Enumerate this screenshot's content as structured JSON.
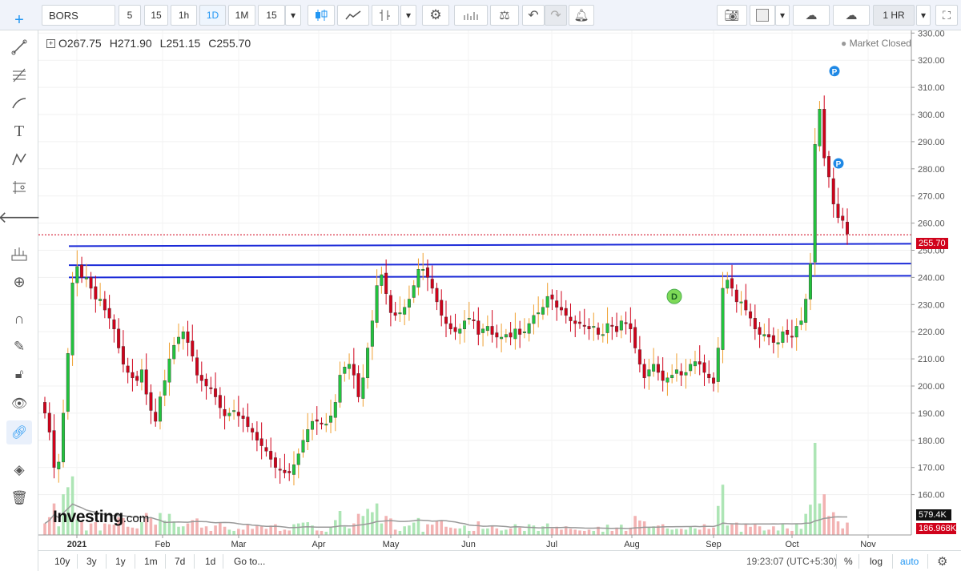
{
  "toolbar": {
    "symbol": "BORS",
    "intervals": [
      "5",
      "15",
      "1h",
      "1D",
      "1M",
      "15"
    ],
    "active_interval": "1D",
    "timezone_button": "1 HR"
  },
  "ohlc": {
    "open": "O267.75",
    "high": "H271.90",
    "low": "L251.15",
    "close": "C255.70"
  },
  "market_status": "Market Closed",
  "logo": {
    "main": "Investing",
    "suffix": ".com"
  },
  "bottom": {
    "ranges": [
      "10y",
      "3y",
      "1y",
      "1m",
      "7d",
      "1d"
    ],
    "goto": "Go to...",
    "clock": "19:23:07 (UTC+5:30)",
    "percent": "%",
    "log": "log",
    "auto": "auto"
  },
  "colors": {
    "up": "#22c33d",
    "down": "#d0021b",
    "line": "#1c2bd8",
    "accent": "#2196f3"
  },
  "chart_data": {
    "type": "candlestick",
    "price_axis": {
      "ticks": [
        160,
        170,
        180,
        190,
        200,
        210,
        220,
        230,
        240,
        250,
        260,
        270,
        280,
        290,
        300,
        310,
        320,
        330
      ]
    },
    "time_axis": {
      "labels": [
        "2021",
        "Feb",
        "Mar",
        "Apr",
        "May",
        "Jun",
        "Jul",
        "Aug",
        "Sep",
        "Oct",
        "Nov"
      ]
    },
    "last_price": "255.70",
    "volume_labels": [
      "579.4K",
      "186.968K"
    ],
    "horizontal_lines": [
      251.5,
      244.5,
      240.0
    ],
    "markers": [
      {
        "label": "P",
        "price": 316
      },
      {
        "label": "P",
        "price": 282
      },
      {
        "label": "D",
        "price": 233
      }
    ],
    "closes": [
      190,
      183,
      170,
      172,
      190,
      212,
      238,
      244,
      240,
      240,
      236,
      232,
      232,
      228,
      225,
      221,
      214,
      208,
      205,
      203,
      202,
      206,
      197,
      191,
      187,
      196,
      202,
      210,
      215,
      218,
      220,
      216,
      211,
      204,
      202,
      200,
      199,
      196,
      192,
      189,
      190,
      191,
      189,
      188,
      185,
      183,
      180,
      178,
      176,
      173,
      170,
      169,
      168,
      168,
      171,
      175,
      180,
      184,
      187,
      187,
      186,
      186,
      189,
      194,
      204,
      207,
      208,
      204,
      196,
      203,
      214,
      224,
      237,
      241,
      234,
      227,
      226,
      227,
      229,
      232,
      237,
      243,
      243,
      240,
      236,
      231,
      226,
      223,
      221,
      220,
      221,
      224,
      225,
      224,
      219,
      221,
      222,
      219,
      218,
      218,
      219,
      218,
      221,
      219,
      220,
      223,
      226,
      227,
      229,
      233,
      232,
      229,
      228,
      226,
      224,
      223,
      223,
      222,
      221,
      222,
      219,
      219,
      223,
      222,
      220,
      224,
      223,
      221,
      214,
      208,
      203,
      206,
      208,
      205,
      202,
      203,
      204,
      206,
      204,
      205,
      208,
      209,
      208,
      205,
      203,
      201,
      214,
      236,
      239,
      236,
      231,
      231,
      228,
      225,
      221,
      219,
      219,
      218,
      216,
      216,
      220,
      219,
      218,
      222,
      224,
      232,
      245,
      289,
      302,
      284,
      277,
      267,
      262,
      261,
      256
    ]
  }
}
